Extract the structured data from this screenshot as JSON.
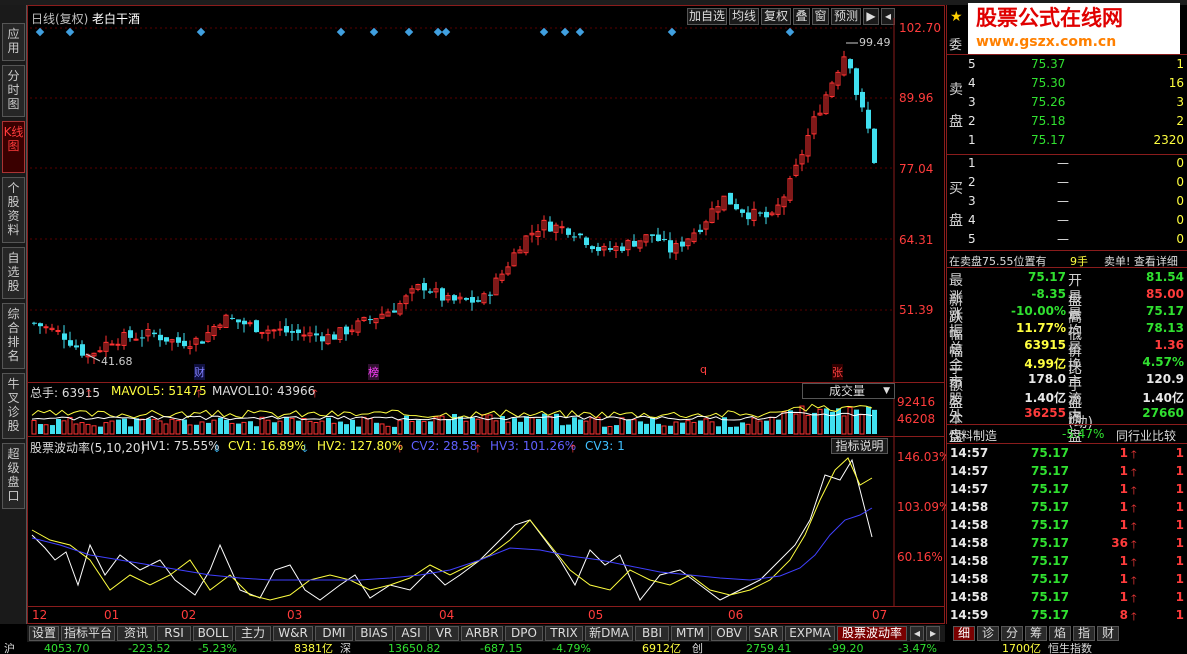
{
  "sidebar": {
    "tabs": [
      "应用",
      "分时图",
      "K线图",
      "个股资料",
      "自选股",
      "综合排名",
      "牛叉诊股",
      "超级盘口"
    ]
  },
  "header": {
    "period_label": "日线(复权)",
    "stock_name": "老白干酒"
  },
  "toolbar": {
    "buttons": [
      "加自选",
      "均线",
      "复权",
      "叠",
      "窗",
      "预测"
    ]
  },
  "price_axis": {
    "labels": [
      "102.70",
      "89.96",
      "77.04",
      "64.31",
      "51.39"
    ]
  },
  "price_annotations": {
    "high": "99.49",
    "low": "41.68"
  },
  "event_markers": {
    "cai": "财",
    "bang": "榜",
    "q": "q",
    "zhang": "张"
  },
  "volume": {
    "label_total": "总手: 63915",
    "label_ma5": "MAVOL5: 51475",
    "label_ma10": "MAVOL10: 43966",
    "axis": [
      "92416",
      "46208"
    ],
    "dropdown": "成交量"
  },
  "indicator": {
    "title": "股票波动率(5,10,20)",
    "hv1": "HV1: 75.55%",
    "cv1": "CV1: 16.89%",
    "hv2": "HV2: 127.80%",
    "cv2": "CV2: 28.58",
    "hv3": "HV3: 101.26%",
    "cv3": "CV3: 1",
    "button": "指标说明",
    "axis": [
      "146.03%",
      "103.09%",
      "60.16%"
    ]
  },
  "date_axis": [
    "12",
    "01",
    "02",
    "03",
    "04",
    "05",
    "06",
    "07"
  ],
  "bottom_tabs": [
    "设置",
    "指标平台",
    "资讯",
    "RSI",
    "BOLL",
    "主力",
    "W&R",
    "DMI",
    "BIAS",
    "ASI",
    "VR",
    "ARBR",
    "DPO",
    "TRIX",
    "新DMA",
    "BBI",
    "MTM",
    "OBV",
    "SAR",
    "EXPMA",
    "股票波动率"
  ],
  "watermark": {
    "title": "股票公式在线网",
    "url": "www.gszx.com.cn"
  },
  "order_book": {
    "wei_label": "委",
    "sell_label": [
      "卖",
      "盘"
    ],
    "buy_label": [
      "买",
      "盘"
    ],
    "sell": [
      {
        "lv": "5",
        "price": "75.37",
        "vol": "1"
      },
      {
        "lv": "4",
        "price": "75.30",
        "vol": "16"
      },
      {
        "lv": "3",
        "price": "75.26",
        "vol": "3"
      },
      {
        "lv": "2",
        "price": "75.18",
        "vol": "2"
      },
      {
        "lv": "1",
        "price": "75.17",
        "vol": "2320"
      }
    ],
    "buy": [
      {
        "lv": "1",
        "price": "—",
        "vol": "0"
      },
      {
        "lv": "2",
        "price": "—",
        "vol": "0"
      },
      {
        "lv": "3",
        "price": "—",
        "vol": "0"
      },
      {
        "lv": "4",
        "price": "—",
        "vol": "0"
      },
      {
        "lv": "5",
        "price": "—",
        "vol": "0"
      }
    ]
  },
  "status_line": {
    "left": "在卖盘75.55位置有",
    "mid": "9手",
    "right": "卖单! 查看详细"
  },
  "stats": [
    {
      "l1": "最新",
      "v1": "75.17",
      "c1": "green",
      "l2": "开盘",
      "v2": "81.54",
      "c2": "green"
    },
    {
      "l1": "涨跌",
      "v1": "-8.35",
      "c1": "green",
      "l2": "最高",
      "v2": "85.00",
      "c2": "red"
    },
    {
      "l1": "涨幅",
      "v1": "-10.00%",
      "c1": "green",
      "l2": "最低",
      "v2": "75.17",
      "c2": "green"
    },
    {
      "l1": "振幅",
      "v1": "11.77%",
      "c1": "yellow",
      "l2": "均价",
      "v2": "78.13",
      "c2": "green"
    },
    {
      "l1": "总手",
      "v1": "63915",
      "c1": "yellow",
      "l2": "量比",
      "v2": "1.36",
      "c2": "red"
    },
    {
      "l1": "金额",
      "v1": "4.99亿",
      "c1": "yellow",
      "l2": "换手",
      "v2": "4.57%",
      "c2": "green"
    },
    {
      "l1": "市盈",
      "v1": "178.0",
      "c1": "white",
      "l2": "市盈(动)",
      "v2": "120.9",
      "c2": "white"
    },
    {
      "l1": "股本",
      "v1": "1.40亿",
      "c1": "white",
      "l2": "流通",
      "v2": "1.40亿",
      "c2": "white"
    },
    {
      "l1": "外盘",
      "v1": "36255",
      "c1": "red",
      "l2": "内盘",
      "v2": "27660",
      "c2": "green"
    }
  ],
  "industry": {
    "name": "饮料制造",
    "change": "-5.47%",
    "compare": "同行业比较"
  },
  "trades": [
    {
      "t": "14:57",
      "p": "75.17",
      "v": "1",
      "c": "red"
    },
    {
      "t": "14:57",
      "p": "75.17",
      "v": "1",
      "c": "red"
    },
    {
      "t": "14:57",
      "p": "75.17",
      "v": "1",
      "c": "red"
    },
    {
      "t": "14:58",
      "p": "75.17",
      "v": "1",
      "c": "red"
    },
    {
      "t": "14:58",
      "p": "75.17",
      "v": "1",
      "c": "red"
    },
    {
      "t": "14:58",
      "p": "75.17",
      "v": "36",
      "c": "red"
    },
    {
      "t": "14:58",
      "p": "75.17",
      "v": "1",
      "c": "red"
    },
    {
      "t": "14:58",
      "p": "75.17",
      "v": "1",
      "c": "red"
    },
    {
      "t": "14:58",
      "p": "75.17",
      "v": "1",
      "c": "red"
    },
    {
      "t": "14:59",
      "p": "75.17",
      "v": "8",
      "c": "red"
    }
  ],
  "right_tabs": [
    "细",
    "诊",
    "分",
    "筹",
    "焰",
    "指",
    "财"
  ],
  "ticker": [
    "沪",
    "4053.70",
    "-223.52",
    "-5.23%",
    "8381亿",
    "深",
    "13650.82",
    "-687.15",
    "-4.79%",
    "6912亿",
    "创",
    "2759.41",
    "-99.20",
    "-3.47%",
    "1700亿",
    "恒生指数"
  ]
}
